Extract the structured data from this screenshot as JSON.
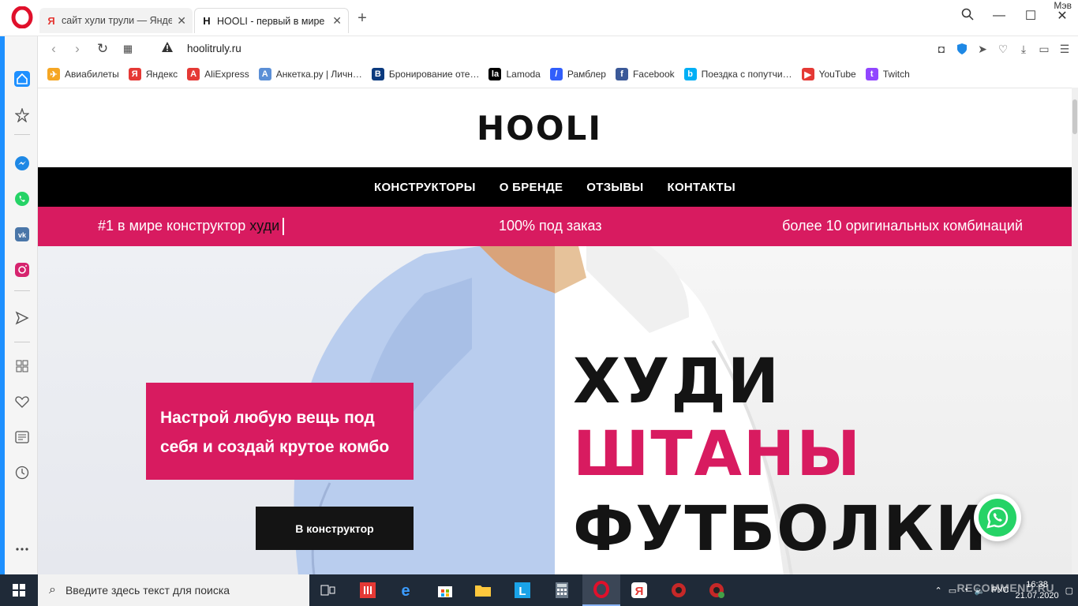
{
  "browser": {
    "tabs": [
      {
        "label": "сайт хули трули — Яндекс",
        "favicon": "yandex-icon"
      },
      {
        "label": "HOOLI - первый в мире к",
        "favicon": "hooli-icon"
      }
    ],
    "user_label": "Мэв",
    "url": "hoolitruly.ru",
    "bookmarks": [
      {
        "label": "Авиабилеты",
        "icon": "plane-icon",
        "color": "#f5a623"
      },
      {
        "label": "Яндекс",
        "icon": "yandex-icon",
        "color": "#e53935"
      },
      {
        "label": "AliExpress",
        "icon": "aliexpress-icon",
        "color": "#e53935"
      },
      {
        "label": "Анкетка.ру | Личн…",
        "icon": "anketka-icon",
        "color": "#5b8fd6"
      },
      {
        "label": "Бронирование оте…",
        "icon": "booking-icon",
        "color": "#0b3a7e"
      },
      {
        "label": "Lamoda",
        "icon": "lamoda-icon",
        "color": "#000000"
      },
      {
        "label": "Рамблер",
        "icon": "rambler-icon",
        "color": "#315efb"
      },
      {
        "label": "Facebook",
        "icon": "facebook-icon",
        "color": "#3b5998"
      },
      {
        "label": "Поездка с попутчи…",
        "icon": "blablacar-icon",
        "color": "#00aff5"
      },
      {
        "label": "YouTube",
        "icon": "youtube-icon",
        "color": "#e53935"
      },
      {
        "label": "Twitch",
        "icon": "twitch-icon",
        "color": "#9146ff"
      }
    ]
  },
  "site": {
    "logo": "HOOLI",
    "nav": [
      "КОНСТРУКТОРЫ",
      "О БРЕНДЕ",
      "ОТЗЫВЫ",
      "КОНТАКТЫ"
    ],
    "promo": {
      "item1_prefix": "#1 в мире конструктор",
      "item1_highlight": "худи",
      "item2": "100% под заказ",
      "item3": "более 10 оригинальных комбинаций"
    },
    "hero": {
      "tagline": "Настрой любую вещь под себя и создай крутое комбо",
      "cta": "В конструктор",
      "word1": "ХУДИ",
      "word2": "ШТАНЫ",
      "word3": "ФУТБОЛКИ"
    },
    "colors": {
      "accent": "#d81b60",
      "dark": "#141414",
      "whatsapp": "#25d366"
    }
  },
  "taskbar": {
    "search_placeholder": "Введите здесь текст для поиска",
    "lang": "РУС",
    "time": "16:38",
    "date": "21.07.2020",
    "watermark": "RECOMMEND.RU"
  }
}
